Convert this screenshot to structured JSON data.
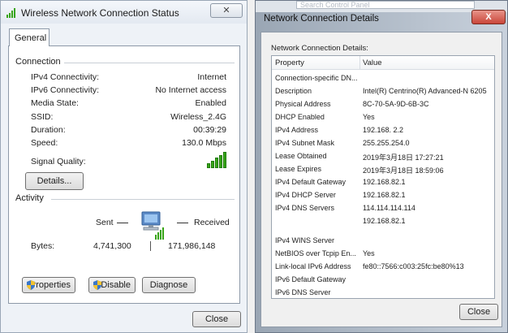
{
  "left_window": {
    "title": "Wireless Network Connection Status",
    "close_glyph": "✕",
    "tab": "General",
    "connection": {
      "group_title": "Connection",
      "rows": [
        {
          "label": "IPv4 Connectivity:",
          "value": "Internet"
        },
        {
          "label": "IPv6 Connectivity:",
          "value": "No Internet access"
        },
        {
          "label": "Media State:",
          "value": "Enabled"
        },
        {
          "label": "SSID:",
          "value": "Wireless_2.4G"
        },
        {
          "label": "Duration:",
          "value": "00:39:29"
        },
        {
          "label": "Speed:",
          "value": "130.0 Mbps"
        }
      ],
      "signal_label": "Signal Quality:",
      "details_button": "Details..."
    },
    "activity": {
      "group_title": "Activity",
      "sent_label": "Sent",
      "received_label": "Received",
      "bytes_label": "Bytes:",
      "bytes_sent": "4,741,300",
      "bytes_received": "171,986,148"
    },
    "buttons": {
      "properties": "Properties",
      "disable": "Disable",
      "diagnose": "Diagnose",
      "close": "Close"
    }
  },
  "right_window": {
    "address_placeholder": "Search Control Panel",
    "title": "Network Connection Details",
    "close_glyph": "X",
    "caption": "Network Connection Details:",
    "columns": {
      "property": "Property",
      "value": "Value"
    },
    "rows": [
      {
        "property": "Connection-specific DN...",
        "value": ""
      },
      {
        "property": "Description",
        "value": "Intel(R) Centrino(R) Advanced-N 6205"
      },
      {
        "property": "Physical Address",
        "value": "8C-70-5A-9D-6B-3C"
      },
      {
        "property": "DHCP Enabled",
        "value": "Yes"
      },
      {
        "property": "IPv4 Address",
        "value": "192.168. 2.2"
      },
      {
        "property": "IPv4 Subnet Mask",
        "value": "255.255.254.0"
      },
      {
        "property": "Lease Obtained",
        "value": "2019年3月18日 17:27:21"
      },
      {
        "property": "Lease Expires",
        "value": "2019年3月18日 18:59:06"
      },
      {
        "property": "IPv4 Default Gateway",
        "value": "192.168.82.1"
      },
      {
        "property": "IPv4 DHCP Server",
        "value": "192.168.82.1"
      },
      {
        "property": "IPv4 DNS Servers",
        "value": "114.114.114.114"
      },
      {
        "property": "",
        "value": "192.168.82.1"
      },
      {
        "property": "IPv4 WINS Server",
        "value": ""
      },
      {
        "property": "NetBIOS over Tcpip En...",
        "value": "Yes"
      },
      {
        "property": "Link-local IPv6 Address",
        "value": "fe80::7566:c003:25fc:be80%13"
      },
      {
        "property": "IPv6 Default Gateway",
        "value": ""
      },
      {
        "property": "IPv6 DNS Server",
        "value": ""
      }
    ],
    "close_button": "Close"
  },
  "colors": {
    "signal_green": "#37a417",
    "close_red": "#c9463a",
    "title_blue_frame": "#9aa6b4"
  }
}
